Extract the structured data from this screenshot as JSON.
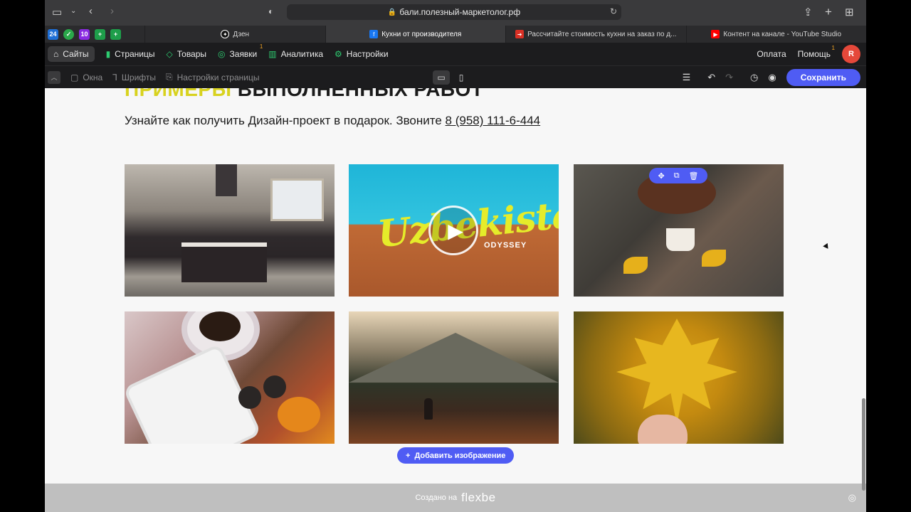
{
  "browser": {
    "url": "бали.полезный-маркетолог.рф",
    "tabs": [
      {
        "label": "Дзен",
        "icon": "dzen-icon"
      },
      {
        "label": "Кухни от производителя",
        "icon": "facebook-icon",
        "active": true
      },
      {
        "label": "Рассчитайте стоимость кухни на заказ по д...",
        "icon": "arrow-right-icon"
      },
      {
        "label": "Контент на канале - YouTube Studio",
        "icon": "youtube-icon"
      }
    ],
    "pinned": [
      "24",
      "✓",
      "10",
      "+",
      "+"
    ]
  },
  "nav": {
    "items": [
      {
        "label": "Сайты",
        "icon": "home-icon",
        "active": true
      },
      {
        "label": "Страницы",
        "icon": "pages-icon"
      },
      {
        "label": "Товары",
        "icon": "tag-icon"
      },
      {
        "label": "Заявки",
        "icon": "leads-icon",
        "badge": "1"
      },
      {
        "label": "Аналитика",
        "icon": "chart-icon"
      },
      {
        "label": "Настройки",
        "icon": "gear-icon"
      }
    ],
    "payment": "Оплата",
    "help": "Помощь",
    "help_badge": "1",
    "avatar": "R"
  },
  "editor": {
    "windows": "Окна",
    "fonts": "Шрифты",
    "page_settings": "Настройки страницы",
    "save": "Сохранить"
  },
  "page": {
    "heading_yellow": "ПРИМЕРЫ",
    "heading_black": "ВЫПОЛНЕННЫХ РАБОТ",
    "subtitle": "Узнайте как получить Дизайн-проект в подарок. Звоните ",
    "phone": "8 (958) 111-6-444",
    "video_title": "Uzbekistan",
    "video_sub": "ODYSSEY",
    "add_image": "Добавить изображение"
  },
  "footer": {
    "made_with": "Создано на",
    "brand": "flexbe"
  },
  "colors": {
    "accent": "#4f5cf4",
    "heading_yellow": "#d8d21e",
    "avatar": "#e5483a"
  }
}
